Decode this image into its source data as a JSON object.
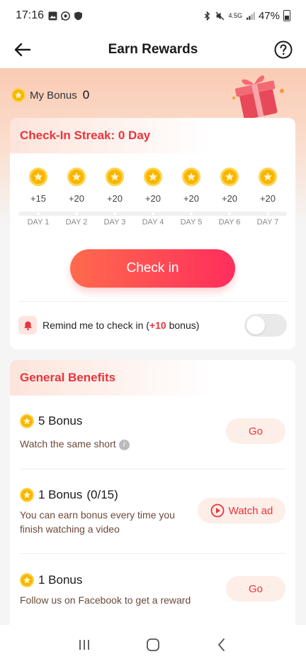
{
  "status_bar": {
    "time": "17:16",
    "battery": "47%",
    "network": "4.5G"
  },
  "header": {
    "title": "Earn Rewards"
  },
  "bonus": {
    "label": "My Bonus",
    "value": "0"
  },
  "checkin": {
    "title": "Check-In Streak: 0 Day",
    "days": [
      {
        "points": "+15",
        "label": "DAY 1"
      },
      {
        "points": "+20",
        "label": "DAY 2"
      },
      {
        "points": "+20",
        "label": "DAY 3"
      },
      {
        "points": "+20",
        "label": "DAY 4"
      },
      {
        "points": "+20",
        "label": "DAY 5"
      },
      {
        "points": "+20",
        "label": "DAY 6"
      },
      {
        "points": "+20",
        "label": "DAY 7"
      }
    ],
    "button_label": "Check in",
    "remind_prefix": "Remind me to check in (",
    "remind_bonus": "+10",
    "remind_suffix": " bonus)",
    "remind_enabled": false
  },
  "benefits": {
    "title": "General Benefits",
    "items": [
      {
        "title": "5 Bonus",
        "progress": "",
        "desc": "Watch the same short",
        "action": "Go",
        "has_info": true
      },
      {
        "title": "1 Bonus",
        "progress": "(0/15)",
        "desc": "You can earn bonus every time you finish watching a video",
        "action": "Watch ad",
        "has_info": false
      },
      {
        "title": "1 Bonus",
        "progress": "",
        "desc": "Follow us on Facebook to get a reward",
        "action": "Go",
        "has_info": false
      }
    ]
  },
  "colors": {
    "accent": "#e8343d",
    "button_start": "#ff6a4d",
    "button_end": "#ff2e5c",
    "coin": "#f7b500"
  }
}
